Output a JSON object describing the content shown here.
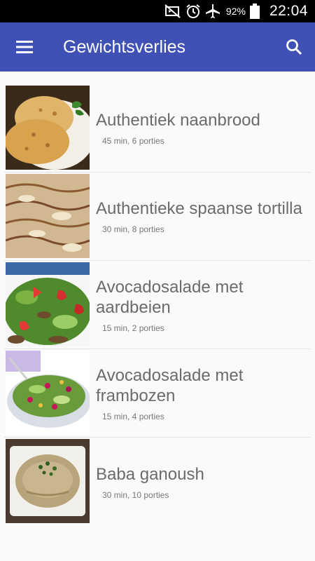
{
  "status_bar": {
    "battery_percent": "92%",
    "time": "22:04",
    "icons": [
      "mute-icon",
      "alarm-icon",
      "airplane-mode-icon",
      "battery-icon"
    ]
  },
  "app_bar": {
    "title": "Gewichtsverlies",
    "menu_icon": "hamburger-menu-icon",
    "search_icon": "search-icon",
    "color": "#3f51b5"
  },
  "recipes": [
    {
      "title": "Authentiek naanbrood",
      "meta": "45 min, 6 porties"
    },
    {
      "title": "Authentieke spaanse tortilla",
      "meta": "30 min, 8 porties"
    },
    {
      "title": "Avocadosalade met aardbeien",
      "meta": "15 min, 2 porties"
    },
    {
      "title": "Avocadosalade met frambozen",
      "meta": "15 min, 4 porties"
    },
    {
      "title": "Baba ganoush",
      "meta": "30 min, 10 porties"
    }
  ]
}
